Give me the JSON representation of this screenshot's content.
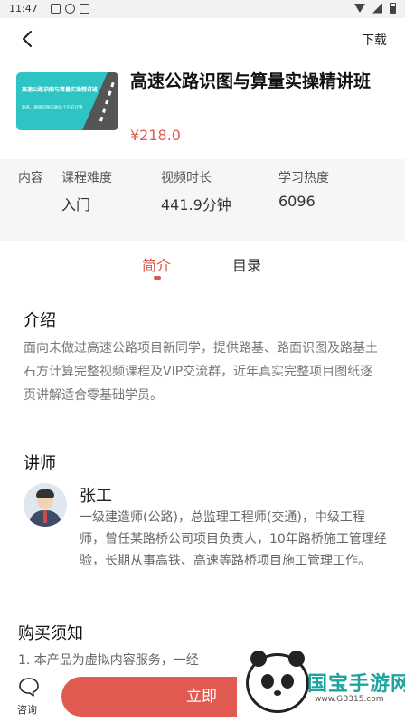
{
  "status_bar": {
    "time": "11:47"
  },
  "header": {
    "download_label": "下载"
  },
  "course": {
    "title": "高速公路识图与算量实操精讲班",
    "price": "¥218.0",
    "cover_title": "高速公路识图与算量实操精讲班",
    "cover_subtitle": "路基、路面识图与路基土石方计算"
  },
  "meta": {
    "section_label": "内容",
    "items": [
      {
        "label": "课程难度",
        "value": "入门"
      },
      {
        "label": "视频时长",
        "value": "441.9分钟"
      },
      {
        "label": "学习热度",
        "value": "6096"
      }
    ]
  },
  "tabs": [
    {
      "label": "简介",
      "active": true
    },
    {
      "label": "目录",
      "active": false
    }
  ],
  "intro": {
    "heading": "介绍",
    "text": "面向未做过高速公路项目新同学，提供路基、路面识图及路基土石方计算完整视频课程及VIP交流群，近年真实完整项目图纸逐页讲解适合零基础学员。"
  },
  "teacher": {
    "heading": "讲师",
    "name": "张工",
    "bio": "一级建造师(公路)，总监理工程师(交通)，中级工程师，曾任某路桥公司项目负责人，10年路桥施工管理经验，长期从事高铁、高速等路桥项目施工管理工作。"
  },
  "notice": {
    "heading": "购买须知",
    "text": "1. 本产品为虚拟内容服务，一经"
  },
  "bottom": {
    "consult_label": "咨询",
    "buy_label": "立即"
  },
  "watermark": {
    "name": "国宝手游网",
    "url": "www.GB315.com"
  },
  "colors": {
    "accent": "#e05a52",
    "tab_active": "#d65a4a",
    "watermark": "#1da5a0"
  },
  "icons": [
    "back-arrow-icon",
    "chat-bubble-icon"
  ]
}
